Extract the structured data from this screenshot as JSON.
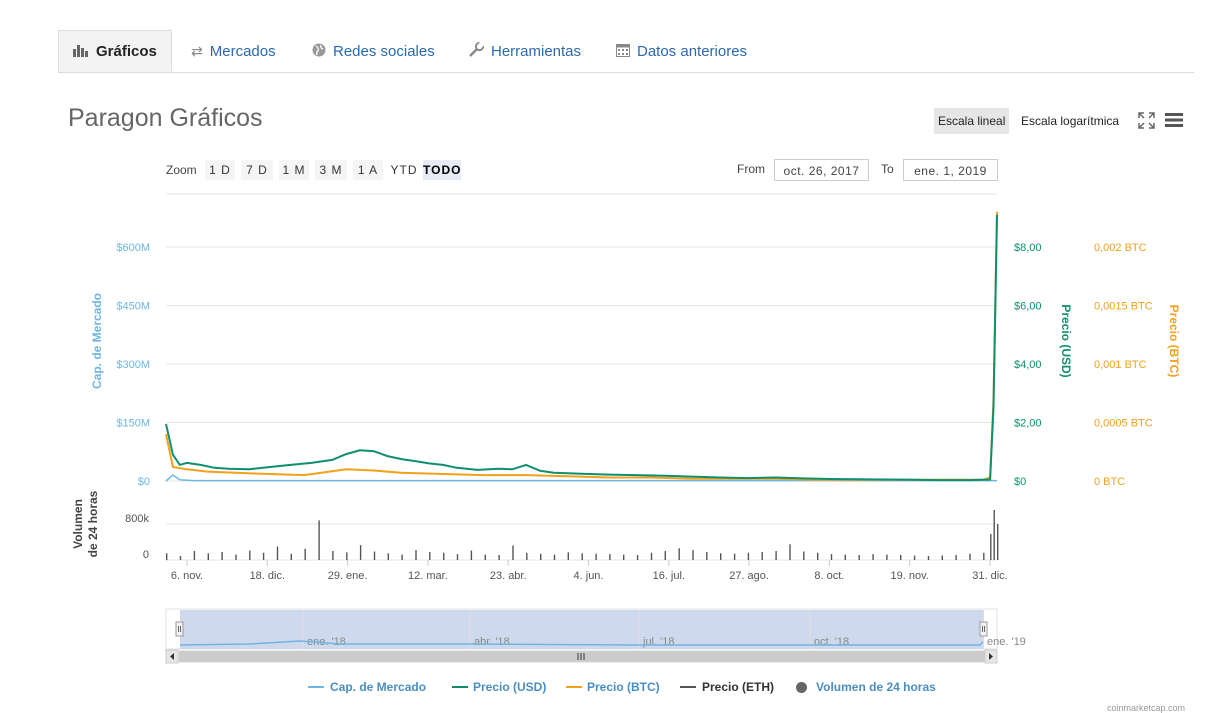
{
  "tabs": [
    {
      "label": "Gráficos",
      "icon": "bar-chart-icon"
    },
    {
      "label": "Mercados",
      "icon": "exchange-arrows-icon"
    },
    {
      "label": "Redes sociales",
      "icon": "globe-icon"
    },
    {
      "label": "Herramientas",
      "icon": "wrench-icon"
    },
    {
      "label": "Datos anteriores",
      "icon": "calendar-icon"
    }
  ],
  "chart_title": "Paragon Gráficos",
  "scale": {
    "linear": "Escala lineal",
    "log": "Escala logarítmica"
  },
  "zoom": {
    "label": "Zoom",
    "buttons": [
      "1 D",
      "7 D",
      "1 M",
      "3 M",
      "1 A",
      "YTD",
      "TODO"
    ],
    "selected": "TODO"
  },
  "range": {
    "from_label": "From",
    "from": "oct. 26, 2017",
    "to_label": "To",
    "to": "ene. 1, 2019"
  },
  "navigator": {
    "labels": [
      "ene. '18",
      "abr. '18",
      "jul. '18",
      "oct. '18",
      "ene. '19"
    ]
  },
  "legend": [
    {
      "label": "Cap. de Mercado",
      "color": "#6fb6e3"
    },
    {
      "label": "Precio (USD)",
      "color": "#0f8f6e"
    },
    {
      "label": "Precio (BTC)",
      "color": "#f3a01b"
    },
    {
      "label": "Precio (ETH)",
      "color": "#555555"
    },
    {
      "label": "Volumen de 24 horas",
      "color": "#666666"
    }
  ],
  "credit": "coinmarketcap.com",
  "chart_data": {
    "type": "line",
    "x_tick_labels": [
      "6. nov.",
      "18. dic.",
      "29. ene.",
      "12. mar.",
      "23. abr.",
      "4. jun.",
      "16. jul.",
      "27. ago.",
      "8. oct.",
      "19. nov.",
      "31. dic."
    ],
    "axes": {
      "market_cap": {
        "title": "Cap. de Mercado",
        "ticks": [
          "$0",
          "$150M",
          "$300M",
          "$450M",
          "$600M"
        ],
        "range": [
          0,
          600
        ],
        "color": "#6fb6e3"
      },
      "price_usd": {
        "title": "Precio (USD)",
        "ticks": [
          "$0",
          "$2,00",
          "$4,00",
          "$6,00",
          "$8,00"
        ],
        "range": [
          0,
          8
        ],
        "color": "#0f8f6e"
      },
      "price_btc": {
        "title": "Precio (BTC)",
        "ticks": [
          "0 BTC",
          "0,0005 BTC",
          "0,001 BTC",
          "0,0015 BTC",
          "0,002 BTC"
        ],
        "range": [
          0,
          0.002
        ],
        "color": "#f3a01b"
      },
      "volume": {
        "title": "Volumen de 24 horas",
        "ticks": [
          "0",
          "800k"
        ],
        "range": [
          0,
          800
        ]
      }
    },
    "series": [
      {
        "name": "Precio (USD)",
        "values": [
          [
            0,
            1.95
          ],
          [
            1,
            0.9
          ],
          [
            2,
            0.55
          ],
          [
            3,
            0.62
          ],
          [
            5,
            0.55
          ],
          [
            7,
            0.45
          ],
          [
            9,
            0.42
          ],
          [
            12,
            0.4
          ],
          [
            15,
            0.48
          ],
          [
            18,
            0.55
          ],
          [
            21,
            0.62
          ],
          [
            24,
            0.72
          ],
          [
            26,
            0.92
          ],
          [
            28,
            1.05
          ],
          [
            30,
            1.02
          ],
          [
            32,
            0.85
          ],
          [
            34,
            0.75
          ],
          [
            36,
            0.68
          ],
          [
            38,
            0.6
          ],
          [
            40,
            0.55
          ],
          [
            42,
            0.45
          ],
          [
            45,
            0.38
          ],
          [
            48,
            0.42
          ],
          [
            50,
            0.4
          ],
          [
            52,
            0.55
          ],
          [
            54,
            0.35
          ],
          [
            56,
            0.28
          ],
          [
            60,
            0.25
          ],
          [
            64,
            0.22
          ],
          [
            68,
            0.2
          ],
          [
            72,
            0.18
          ],
          [
            76,
            0.15
          ],
          [
            80,
            0.12
          ],
          [
            84,
            0.1
          ],
          [
            88,
            0.12
          ],
          [
            92,
            0.09
          ],
          [
            96,
            0.07
          ],
          [
            100,
            0.06
          ],
          [
            104,
            0.05
          ],
          [
            108,
            0.04
          ],
          [
            112,
            0.03
          ],
          [
            116,
            0.03
          ],
          [
            119,
            0.05
          ],
          [
            119.5,
            2.5
          ],
          [
            120,
            9.1
          ]
        ]
      },
      {
        "name": "Precio (BTC)",
        "values": [
          [
            0,
            0.0004
          ],
          [
            1,
            0.00012
          ],
          [
            3,
            0.0001
          ],
          [
            6,
            8e-05
          ],
          [
            10,
            7e-05
          ],
          [
            15,
            6e-05
          ],
          [
            20,
            5e-05
          ],
          [
            26,
            0.0001
          ],
          [
            30,
            9e-05
          ],
          [
            34,
            7e-05
          ],
          [
            40,
            6e-05
          ],
          [
            46,
            5e-05
          ],
          [
            52,
            5e-05
          ],
          [
            58,
            4e-05
          ],
          [
            64,
            3e-05
          ],
          [
            70,
            3e-05
          ],
          [
            76,
            2e-05
          ],
          [
            82,
            2e-05
          ],
          [
            88,
            2e-05
          ],
          [
            94,
            1e-05
          ],
          [
            100,
            1e-05
          ],
          [
            106,
            1e-05
          ],
          [
            112,
            1e-05
          ],
          [
            118,
            1e-05
          ],
          [
            119,
            3e-05
          ],
          [
            119.5,
            0.0007
          ],
          [
            120,
            0.0023
          ]
        ]
      },
      {
        "name": "Cap. de Mercado",
        "values": [
          [
            0,
            0
          ],
          [
            1,
            15
          ],
          [
            2,
            3
          ],
          [
            4,
            1
          ],
          [
            120,
            1
          ]
        ]
      },
      {
        "name": "Volumen de 24 horas",
        "values": [
          [
            0,
            150
          ],
          [
            2,
            90
          ],
          [
            4,
            200
          ],
          [
            6,
            150
          ],
          [
            8,
            180
          ],
          [
            10,
            120
          ],
          [
            12,
            210
          ],
          [
            14,
            160
          ],
          [
            16,
            300
          ],
          [
            18,
            140
          ],
          [
            20,
            250
          ],
          [
            22,
            880
          ],
          [
            24,
            200
          ],
          [
            26,
            170
          ],
          [
            28,
            330
          ],
          [
            30,
            190
          ],
          [
            32,
            150
          ],
          [
            34,
            120
          ],
          [
            36,
            220
          ],
          [
            38,
            180
          ],
          [
            40,
            160
          ],
          [
            42,
            130
          ],
          [
            44,
            210
          ],
          [
            46,
            120
          ],
          [
            48,
            110
          ],
          [
            50,
            320
          ],
          [
            52,
            160
          ],
          [
            54,
            140
          ],
          [
            56,
            120
          ],
          [
            58,
            170
          ],
          [
            60,
            150
          ],
          [
            62,
            140
          ],
          [
            64,
            130
          ],
          [
            66,
            120
          ],
          [
            68,
            110
          ],
          [
            70,
            160
          ],
          [
            72,
            200
          ],
          [
            74,
            260
          ],
          [
            76,
            220
          ],
          [
            78,
            180
          ],
          [
            80,
            150
          ],
          [
            82,
            140
          ],
          [
            84,
            160
          ],
          [
            86,
            180
          ],
          [
            88,
            200
          ],
          [
            90,
            350
          ],
          [
            92,
            190
          ],
          [
            94,
            160
          ],
          [
            96,
            130
          ],
          [
            98,
            120
          ],
          [
            100,
            110
          ],
          [
            102,
            130
          ],
          [
            104,
            120
          ],
          [
            106,
            110
          ],
          [
            108,
            100
          ],
          [
            110,
            90
          ],
          [
            112,
            100
          ],
          [
            114,
            110
          ],
          [
            116,
            140
          ],
          [
            118,
            160
          ],
          [
            119,
            580
          ],
          [
            119.5,
            1200
          ],
          [
            120,
            800
          ]
        ]
      }
    ],
    "grid": true,
    "legend_position": "bottom"
  }
}
